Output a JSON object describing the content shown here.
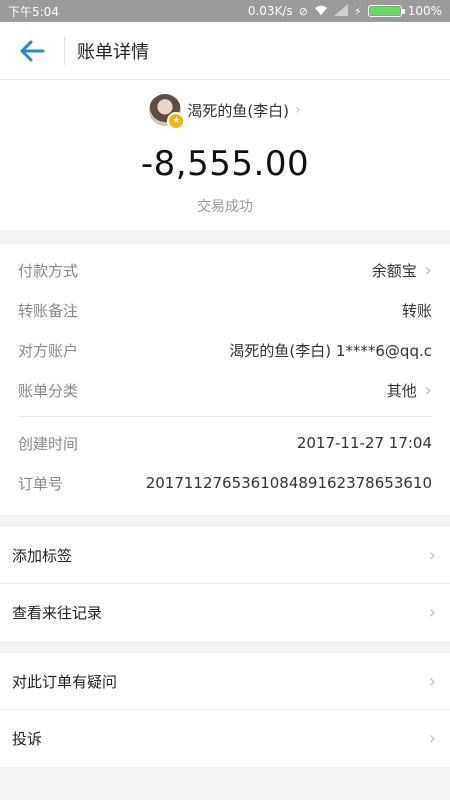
{
  "status_bar": {
    "time": "下午5:04",
    "net_speed": "0.03K/s",
    "battery": "100%"
  },
  "nav": {
    "title": "账单详情"
  },
  "summary": {
    "counterparty": "渴死的鱼(李白)",
    "amount": "-8,555.00",
    "status": "交易成功"
  },
  "details": [
    {
      "label": "付款方式",
      "value": "余额宝",
      "arrow": true
    },
    {
      "label": "转账备注",
      "value": "转账",
      "arrow": false
    },
    {
      "label": "对方账户",
      "value": "渴死的鱼(李白) 1****6@qq.c",
      "arrow": false
    },
    {
      "label": "账单分类",
      "value": "其他",
      "arrow": true
    }
  ],
  "details_extra": [
    {
      "label": "创建时间",
      "value": "2017-11-27 17:04"
    },
    {
      "label": "订单号",
      "value": "20171127653610848916237865361​0"
    }
  ],
  "actions_group1": [
    {
      "label": "添加标签"
    },
    {
      "label": "查看来往记录"
    }
  ],
  "actions_group2": [
    {
      "label": "对此订单有疑问"
    },
    {
      "label": "投诉"
    }
  ],
  "colors": {
    "accent": "#1a8cd8",
    "statusbar": "#9b9b9b"
  }
}
